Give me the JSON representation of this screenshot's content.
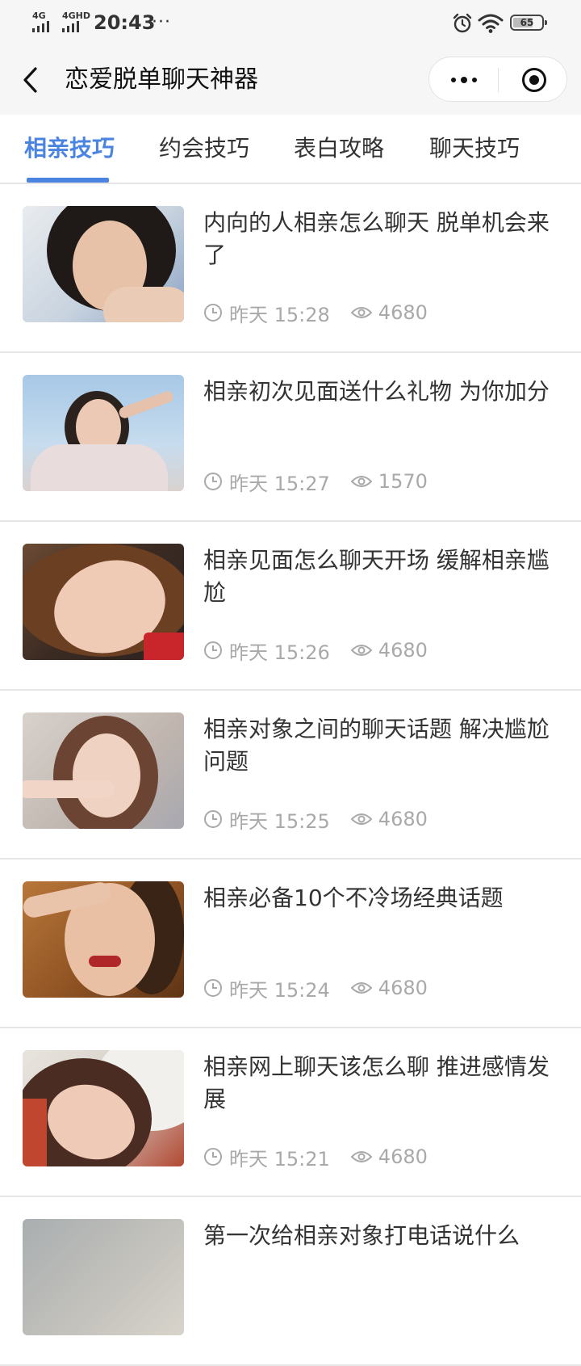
{
  "status_bar": {
    "signal1": "4G",
    "signal2": "4GHD",
    "time": "20:43",
    "more": "···",
    "battery": "65"
  },
  "nav": {
    "title": "恋爱脱单聊天神器"
  },
  "tabs": [
    {
      "label": "相亲技巧",
      "active": true
    },
    {
      "label": "约会技巧",
      "active": false
    },
    {
      "label": "表白攻略",
      "active": false
    },
    {
      "label": "聊天技巧",
      "active": false
    }
  ],
  "articles": [
    {
      "title": "内向的人相亲怎么聊天 脱单机会来了",
      "time": "昨天 15:28",
      "views": "4680",
      "thumb_icon": "woman-portrait-image"
    },
    {
      "title": "相亲初次见面送什么礼物 为你加分",
      "time": "昨天 15:27",
      "views": "1570",
      "thumb_icon": "woman-portrait-image"
    },
    {
      "title": "相亲见面怎么聊天开场 缓解相亲尴尬",
      "time": "昨天 15:26",
      "views": "4680",
      "thumb_icon": "woman-portrait-image"
    },
    {
      "title": "相亲对象之间的聊天话题 解决尴尬问题",
      "time": "昨天 15:25",
      "views": "4680",
      "thumb_icon": "woman-portrait-image"
    },
    {
      "title": "相亲必备10个不冷场经典话题",
      "time": "昨天 15:24",
      "views": "4680",
      "thumb_icon": "woman-portrait-image"
    },
    {
      "title": "相亲网上聊天该怎么聊 推进感情发展",
      "time": "昨天 15:21",
      "views": "4680",
      "thumb_icon": "woman-portrait-image"
    },
    {
      "title": "第一次给相亲对象打电话说什么",
      "time": "",
      "views": "",
      "thumb_icon": "woman-portrait-image"
    }
  ],
  "colors": {
    "accent": "#4a84e0",
    "meta_gray": "#a9a9a9",
    "bar_bg": "#f6f6f6"
  }
}
